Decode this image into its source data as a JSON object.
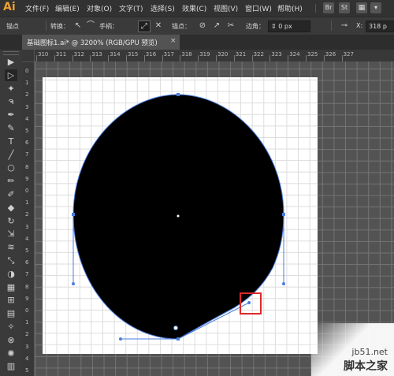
{
  "app": {
    "logo": "Ai"
  },
  "menu": [
    "文件(F)",
    "编辑(E)",
    "对象(O)",
    "文字(T)",
    "选择(S)",
    "效果(C)",
    "视图(V)",
    "窗口(W)",
    "帮助(H)"
  ],
  "menu_buttons": [
    "Br",
    "St"
  ],
  "control": {
    "mode_label": "锚点",
    "convert_label": "转换：",
    "handle_label": "手柄：",
    "anchor_label": "锚点：",
    "corner_label": "边角：",
    "corner_value": "0 px",
    "x_label": "X:",
    "x_value": "318 p"
  },
  "document_tab": {
    "title": "基础图标1.ai* @ 3200% (RGB/GPU 预览)",
    "close": "×"
  },
  "hruler_ticks": [
    "310",
    "311",
    "312",
    "313",
    "314",
    "315",
    "316",
    "317",
    "318",
    "319",
    "320",
    "321",
    "322",
    "323",
    "324",
    "325",
    "326",
    "327"
  ],
  "vruler_ticks": [
    "0",
    "1",
    "2",
    "3",
    "4",
    "5",
    "6",
    "7",
    "8",
    "9",
    "0",
    "1",
    "2",
    "3",
    "4",
    "5",
    "6",
    "7",
    "8",
    "9",
    "0",
    "1",
    "2",
    "3",
    "4",
    "5"
  ],
  "tools": [
    "selection-arrow-icon",
    "direct-selection-icon",
    "magic-wand-icon",
    "lasso-icon",
    "pen-icon",
    "curvature-icon",
    "type-icon",
    "line-icon",
    "ellipse-icon",
    "paintbrush-icon",
    "pencil-icon",
    "eraser-icon",
    "rotate-icon",
    "scale-icon",
    "width-icon",
    "free-transform-icon",
    "shape-builder-icon",
    "perspective-icon",
    "mesh-icon",
    "gradient-icon",
    "eyedropper-icon",
    "blend-icon",
    "symbol-sprayer-icon",
    "graph-icon"
  ],
  "tool_glyphs": [
    "▶",
    "▷",
    "✦",
    "ຈ",
    "✒",
    "✎",
    "T",
    "╱",
    "○",
    "✏",
    "✐",
    "◆",
    "↻",
    "⇲",
    "≋",
    "⤡",
    "◑",
    "▦",
    "⊞",
    "▤",
    "✧",
    "⊗",
    "✺",
    "▥"
  ],
  "colors": {
    "path": "#4a7de0",
    "highlight": "#e02828",
    "shape": "#000000"
  },
  "watermark": {
    "site": "jb51.net",
    "name": "脚本之家"
  }
}
